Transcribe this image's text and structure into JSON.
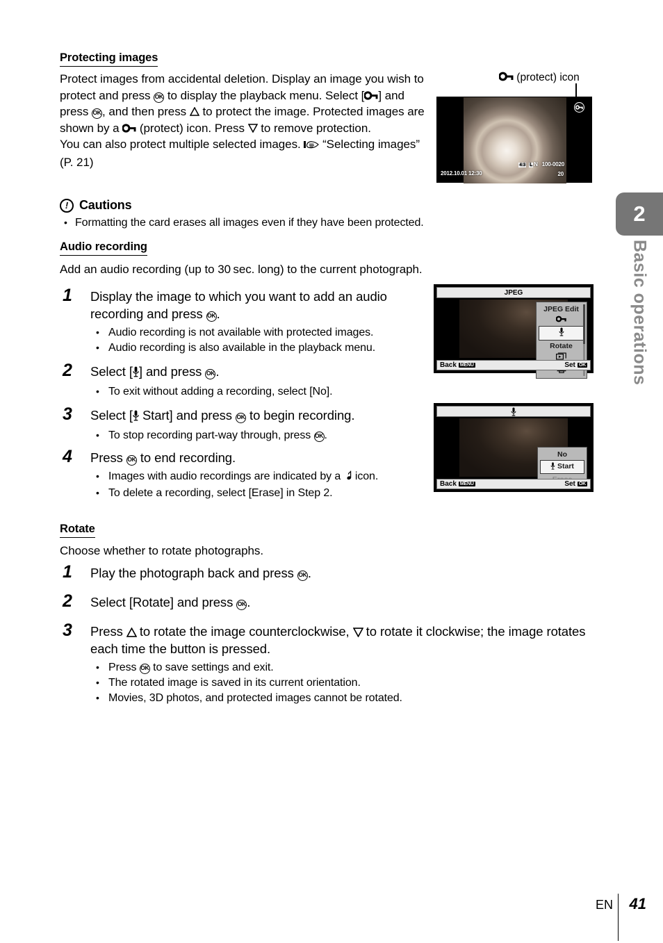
{
  "sidebar": {
    "chapter_number": "2",
    "chapter_title": "Basic operations",
    "tab_color": "#767676",
    "label_color": "#8a8a8a"
  },
  "sections": {
    "protecting": {
      "heading": "Protecting images",
      "para_1": "Protect images from accidental deletion. Display an image you wish to protect and press ",
      "para_2": " to display the playback menu. Select [",
      "para_3": "] and press ",
      "para_4": ", and then press ",
      "para_5": " to protect the image. Protected images are shown by a ",
      "para_6": " (protect) icon. Press ",
      "para_7": " to remove protection.",
      "para_8": "You can also protect multiple selected images. ",
      "para_9": " “Selecting images” (P. 21)"
    },
    "cautions": {
      "heading": "Cautions",
      "icon": "exclamation-circle-icon",
      "items": [
        "Formatting the card erases all images even if they have been protected."
      ]
    },
    "audio": {
      "heading": "Audio recording",
      "intro": "Add an audio recording (up to 30 sec. long) to the current photograph.",
      "steps": [
        {
          "num": "1",
          "text_a": "Display the image to which you want to add an audio recording and press ",
          "text_b": ".",
          "bullets": [
            "Audio recording is not available with protected images.",
            "Audio recording is also available in the playback menu."
          ]
        },
        {
          "num": "2",
          "text_a": "Select [",
          "text_b": "] and press ",
          "text_c": ".",
          "bullets": [
            "To exit without adding a recording, select [No]."
          ]
        },
        {
          "num": "3",
          "text_a": "Select [",
          "text_b": " Start] and press ",
          "text_c": " to begin recording.",
          "bullets": [
            "To stop recording part-way through, press "
          ],
          "bullet_suffix": "."
        },
        {
          "num": "4",
          "text_a": "Press ",
          "text_b": " to end recording.",
          "bullets": [
            "Images with audio recordings are indicated by a ",
            "To delete a recording, select [Erase] in Step 2."
          ],
          "bullet_tail": " icon."
        }
      ]
    },
    "rotate": {
      "heading": "Rotate",
      "intro": "Choose whether to rotate photographs.",
      "steps": [
        {
          "num": "1",
          "text_a": "Play the photograph back and press ",
          "text_b": "."
        },
        {
          "num": "2",
          "text_a": "Select [Rotate] and press ",
          "text_b": "."
        },
        {
          "num": "3",
          "text_a": "Press ",
          "text_b": " to rotate the image counterclockwise, ",
          "text_c": " to rotate it clockwise; the image rotates each time the button is pressed.",
          "bullets": [
            "Press ",
            "The rotated image is saved in its current orientation.",
            "Movies, 3D photos, and protected images cannot be rotated."
          ],
          "bullet_tail": " to save settings and exit."
        }
      ]
    }
  },
  "figures": {
    "protect_photo": {
      "caption_text": " (protect) icon",
      "caption_icon": "protect-key-icon",
      "overlay_datetime": "2012.10.01 12:30",
      "overlay_aspect": "4:3",
      "overlay_quality_l": "L",
      "overlay_quality_n": "N",
      "overlay_filenum": "100-0020",
      "overlay_framenum": "20",
      "badge_icon": "protect-key-icon"
    },
    "jpeg_menu": {
      "title": "JPEG",
      "menu_header": "JPEG Edit",
      "items": [
        {
          "label": "",
          "icon": "protect-key-icon",
          "selected": false,
          "disabled": false
        },
        {
          "label": "",
          "icon": "microphone-icon",
          "selected": true,
          "disabled": false
        },
        {
          "label": "Rotate",
          "icon": "",
          "selected": false,
          "disabled": false
        },
        {
          "label": "",
          "icon": "slideshow-icon",
          "selected": false,
          "disabled": false
        },
        {
          "label": "",
          "icon": "print-icon",
          "selected": false,
          "disabled": false
        }
      ],
      "back_label": "Back",
      "back_chip": "MENU",
      "set_label": "Set",
      "set_chip": "OK"
    },
    "audio_menu": {
      "title_icon": "microphone-icon",
      "items": [
        {
          "label": "No",
          "icon": "",
          "selected": false,
          "disabled": false
        },
        {
          "label": "Start",
          "icon": "microphone-icon",
          "selected": true,
          "disabled": false
        },
        {
          "label": "Erase",
          "icon": "",
          "selected": false,
          "disabled": true
        }
      ],
      "back_label": "Back",
      "back_chip": "MENU",
      "set_label": "Set",
      "set_chip": "OK"
    }
  },
  "footer": {
    "lang": "EN",
    "page": "41"
  }
}
